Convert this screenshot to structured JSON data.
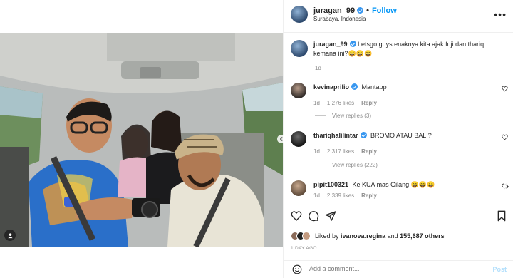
{
  "post": {
    "username": "juragan_99",
    "follow_label": "Follow",
    "location": "Surabaya, Indonesia",
    "caption": "Letsgo guys enaknya kita ajak fuji dan thariq kemana ini?😄😄😄",
    "caption_time": "1d"
  },
  "comments": [
    {
      "username": "kevinaprilio",
      "text": "Mantapp",
      "time": "1d",
      "likes": "1,276 likes",
      "reply": "Reply",
      "view_replies": "View replies (3)",
      "verified": true
    },
    {
      "username": "thariqhalilintar",
      "text": "BROMO ATAU BALI?",
      "time": "1d",
      "likes": "2,317 likes",
      "reply": "Reply",
      "view_replies": "View replies (222)",
      "verified": true
    },
    {
      "username": "pipit100321",
      "text": "Ke KUA mas Gilang 😄😄😄",
      "time": "1d",
      "likes": "2,339 likes",
      "reply": "Reply",
      "verified": false
    }
  ],
  "likes": {
    "prefix": "Liked by",
    "user": "ivanova.regina",
    "middle": "and",
    "others": "155,687 others"
  },
  "time_ago": "1 DAY AGO",
  "add_comment": {
    "placeholder": "Add a comment...",
    "post_label": "Post"
  },
  "colors": {
    "accent": "#0095f6",
    "verified": "#3897f0",
    "muted": "#8e8e8e"
  }
}
